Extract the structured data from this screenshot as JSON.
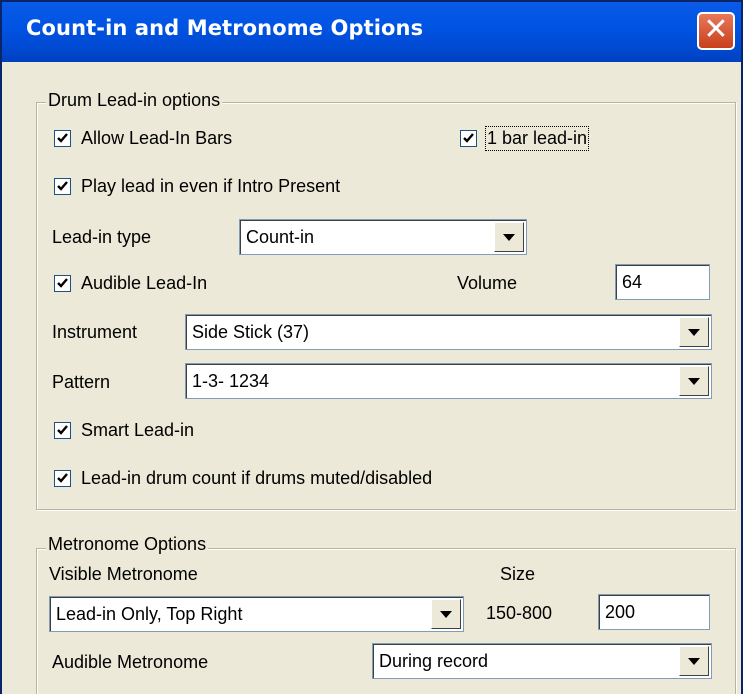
{
  "window": {
    "title": "Count-in and Metronome Options",
    "close_glyph": "✕"
  },
  "drum_group": {
    "title": "Drum Lead-in options",
    "allow_lead_in_bars": {
      "label": "Allow Lead-In Bars",
      "checked": true
    },
    "one_bar_lead_in": {
      "label": "1 bar lead-in",
      "checked": true
    },
    "play_lead_in_intro": {
      "label": "Play lead in even if Intro Present",
      "checked": true
    },
    "lead_in_type": {
      "label": "Lead-in type",
      "value": "Count-in"
    },
    "audible_lead_in": {
      "label": "Audible Lead-In",
      "checked": true
    },
    "volume": {
      "label": "Volume",
      "value": "64"
    },
    "instrument": {
      "label": "Instrument",
      "value": "Side Stick (37)"
    },
    "pattern": {
      "label": "Pattern",
      "value": "1-3- 1234"
    },
    "smart_lead_in": {
      "label": "Smart Lead-in",
      "checked": true
    },
    "drum_count_muted": {
      "label": "Lead-in drum count if drums muted/disabled",
      "checked": true
    }
  },
  "metronome_group": {
    "title": "Metronome Options",
    "visible_metronome": {
      "label": "Visible Metronome",
      "value": "Lead-in Only, Top Right"
    },
    "size": {
      "label": "Size",
      "range": "150-800",
      "value": "200"
    },
    "audible_metronome": {
      "label": "Audible Metronome",
      "value": "During record"
    }
  },
  "colors": {
    "titlebar": "#0054e3",
    "dialog_bg": "#ece9d8",
    "close_button": "#d6512f"
  }
}
